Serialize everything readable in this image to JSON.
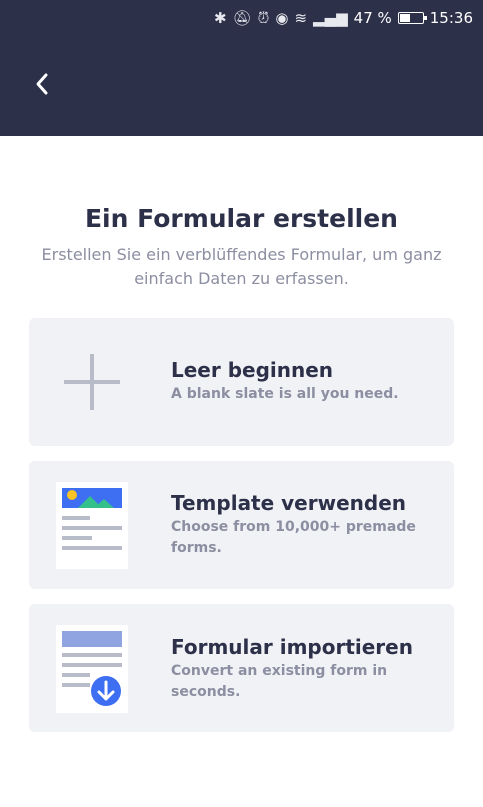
{
  "status_bar": {
    "icons": [
      "bluetooth-icon",
      "mute-icon",
      "alarm-icon",
      "eye-icon",
      "wifi-icon",
      "signal-icon"
    ],
    "battery": "47 %",
    "battery_level": 0.47,
    "time": "15:36"
  },
  "header": {
    "back_icon": "chevron-left-icon"
  },
  "main": {
    "title": "Ein Formular erstellen",
    "subtitle": "Erstellen Sie ein verblüffendes Formular, um ganz einfach Daten zu erfassen.",
    "options": [
      {
        "label": "Leer beginnen",
        "description": "A blank slate is all you need.",
        "icon": "plus-icon"
      },
      {
        "label": "Template verwenden",
        "description": "Choose from 10,000+ premade forms.",
        "icon": "template-icon"
      },
      {
        "label": "Formular importieren",
        "description": "Convert an existing form in seconds.",
        "icon": "import-icon"
      }
    ]
  },
  "colors": {
    "header_bg": "#2d3049",
    "card_bg": "#f1f2f6",
    "accent_blue": "#3e6ff2",
    "title": "#2d3049",
    "muted": "#8c8ea1"
  }
}
